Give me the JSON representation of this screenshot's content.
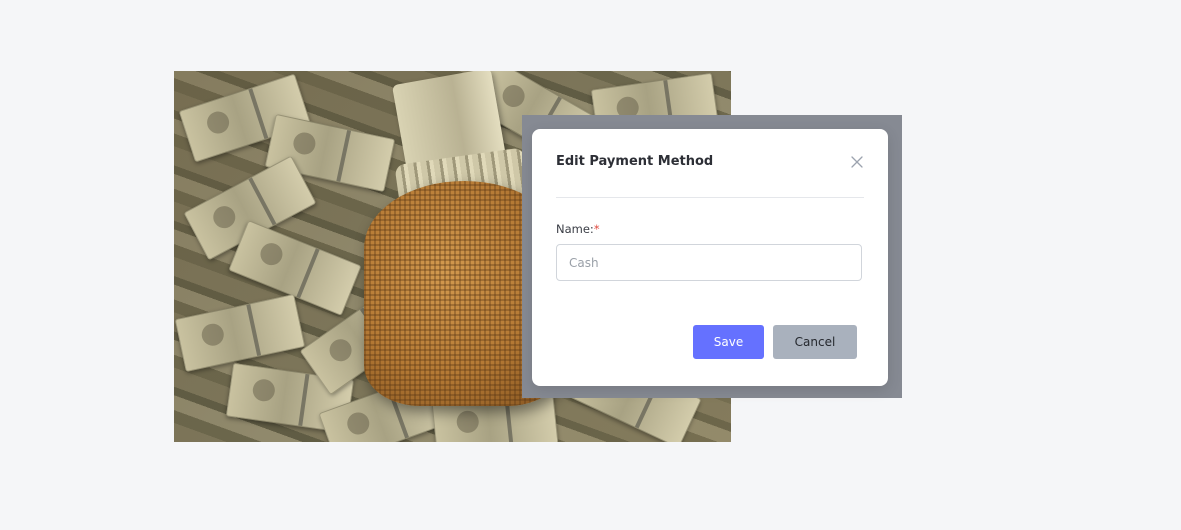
{
  "modal": {
    "title": "Edit Payment Method",
    "name_label": "Name:",
    "required_marker": "*",
    "name_value": "",
    "name_placeholder": "Cash",
    "save_label": "Save",
    "cancel_label": "Cancel"
  },
  "icons": {
    "close": "close-icon"
  },
  "colors": {
    "page_background": "#f5f6f8",
    "save_button": "#6571ff",
    "cancel_button": "#a9b1bd",
    "required": "#e0483e"
  }
}
